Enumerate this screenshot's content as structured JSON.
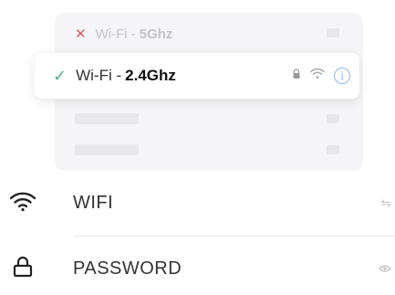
{
  "network_list": {
    "item_5g": {
      "status_icon": "x-icon",
      "prefix": "Wi-Fi -",
      "band": "5Ghz"
    },
    "selected": {
      "status_icon": "check-icon",
      "prefix": "Wi-Fi -",
      "band": "2.4Ghz",
      "icons": [
        "lock-icon",
        "wifi-signal-icon",
        "info-icon"
      ]
    }
  },
  "form": {
    "wifi": {
      "label": "WIFI",
      "icon": "wifi-icon",
      "trailing_icon": "swap-icon"
    },
    "password": {
      "label": "PASSWORD",
      "icon": "lock-icon",
      "trailing_icon": "eye-icon"
    }
  },
  "colors": {
    "accent_green": "#58b48a",
    "error_red": "#e05a5a",
    "info_blue": "#8fb8f0"
  }
}
